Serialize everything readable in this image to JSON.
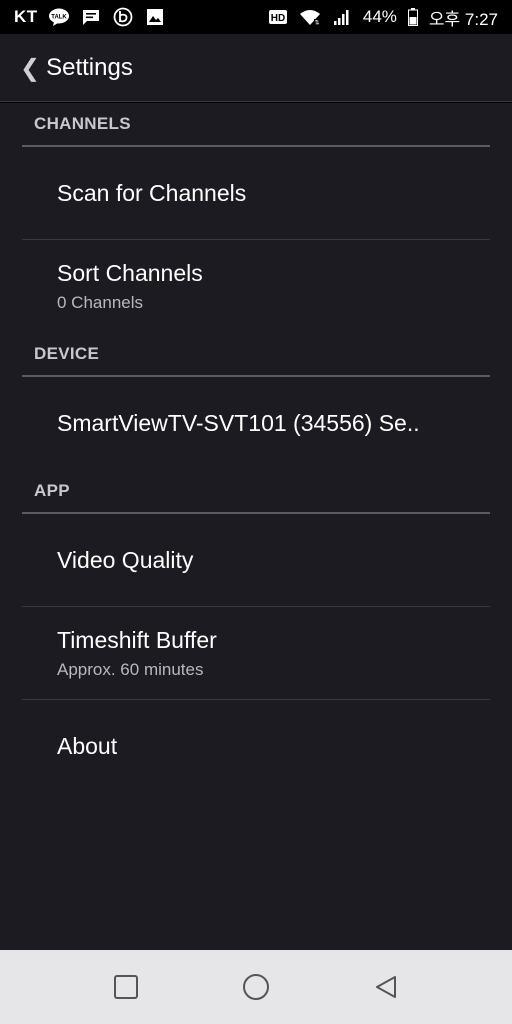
{
  "status_bar": {
    "carrier": "KT",
    "battery": "44%",
    "time": "오후 7:27",
    "left_icons": [
      "kakaotalk-icon",
      "message-icon",
      "b-app-icon",
      "gallery-icon"
    ],
    "right_icons": [
      "hd-icon",
      "wifi-icon",
      "signal-icon",
      "battery-icon"
    ]
  },
  "app_bar": {
    "back_chevron": "❮",
    "title": "Settings"
  },
  "sections": {
    "channels": {
      "header": "CHANNELS",
      "scan": {
        "title": "Scan for Channels"
      },
      "sort": {
        "title": "Sort Channels",
        "summary": "0 Channels"
      }
    },
    "device": {
      "header": "DEVICE",
      "device_item": {
        "title": "SmartViewTV-SVT101  (34556) Se.."
      }
    },
    "app": {
      "header": "APP",
      "video_quality": {
        "title": "Video Quality"
      },
      "timeshift": {
        "title": "Timeshift Buffer",
        "summary": "Approx. 60 minutes"
      },
      "about": {
        "title": "About"
      }
    }
  },
  "nav_bar": {
    "buttons": [
      "recents-icon",
      "home-icon",
      "back-icon"
    ]
  },
  "colors": {
    "background": "#1c1b21",
    "status_bar": "#000000",
    "nav_bar": "#e6e6e8",
    "section_header_text": "#c7c7cc",
    "divider": "#3a3940"
  }
}
